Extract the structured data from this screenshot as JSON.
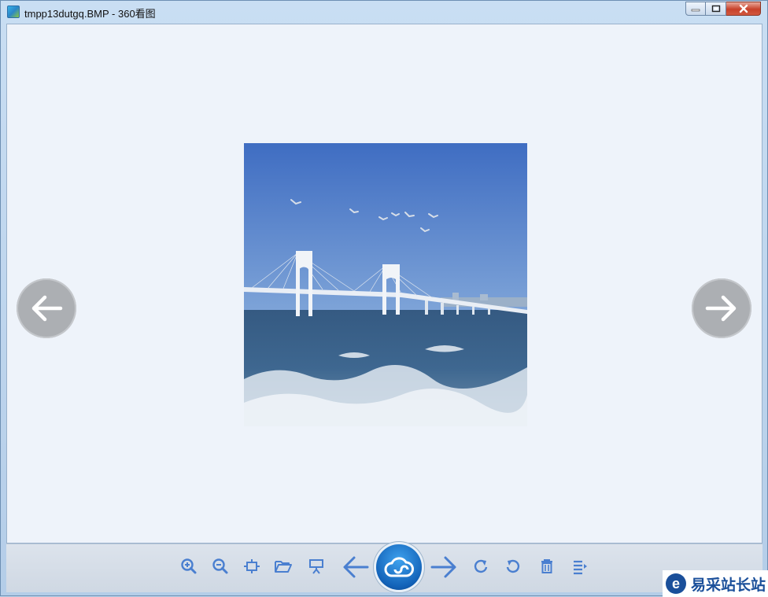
{
  "window": {
    "title": "tmpp13dutgq.BMP - 360看图"
  },
  "viewer": {
    "prev_icon": "arrow-left-icon",
    "next_icon": "arrow-right-icon"
  },
  "toolbar": {
    "buttons": [
      {
        "icon": "zoom-in-icon"
      },
      {
        "icon": "zoom-out-icon"
      },
      {
        "icon": "fit-to-window-icon"
      },
      {
        "icon": "open-folder-icon"
      },
      {
        "icon": "slideshow-icon"
      },
      {
        "icon": "arrow-left-icon"
      },
      {
        "icon": "cloud-icon"
      },
      {
        "icon": "arrow-right-icon"
      },
      {
        "icon": "rotate-clockwise-icon"
      },
      {
        "icon": "rotate-counterclockwise-icon"
      },
      {
        "icon": "delete-icon"
      },
      {
        "icon": "menu-icon"
      }
    ],
    "accent_color": "#4a7fd0"
  },
  "watermark": {
    "text": "易采站长站"
  }
}
